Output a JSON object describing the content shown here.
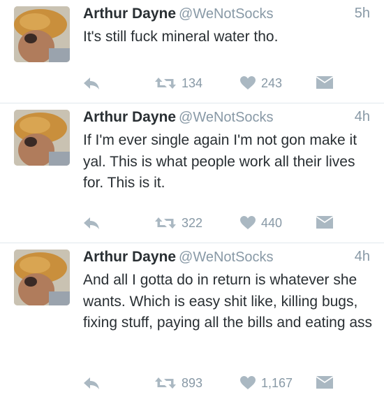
{
  "colors": {
    "text": "#292f33",
    "meta": "#8899a6",
    "icon": "#aab8c2",
    "divider": "#e1e8ed"
  },
  "tweets": [
    {
      "name": "Arthur Dayne",
      "handle": "@WeNotSocks",
      "time": "5h",
      "text": "It's still fuck mineral water tho.",
      "retweets": "134",
      "likes": "243"
    },
    {
      "name": "Arthur Dayne",
      "handle": "@WeNotSocks",
      "time": "4h",
      "text": "If I'm ever single again I'm not gon make it yal. This is what people work all their lives for. This is it.",
      "retweets": "322",
      "likes": "440"
    },
    {
      "name": "Arthur Dayne",
      "handle": "@WeNotSocks",
      "time": "4h",
      "text": "And all I gotta do in return is whatever she wants. Which is easy shit like, killing bugs, fixing stuff, paying all the bills and eating ass",
      "retweets": "893",
      "likes": "1,167"
    }
  ],
  "icons": {
    "reply": "reply-icon",
    "retweet": "retweet-icon",
    "like": "heart-icon",
    "dm": "envelope-icon"
  }
}
